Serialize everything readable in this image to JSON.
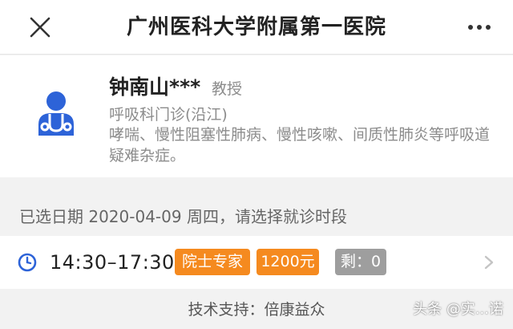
{
  "header": {
    "title": "广州医科大学附属第一医院",
    "close_icon": "close-icon",
    "more_icon": "more-dots-icon"
  },
  "doctor": {
    "icon": "doctor-stethoscope-icon",
    "name": "钟南山***",
    "title": "教授",
    "department": "呼吸科门诊(沿江)",
    "specialty": "哮喘、慢性阻塞性肺病、慢性咳嗽、间质性肺炎等呼吸道疑难杂症。"
  },
  "schedule": {
    "selected_date_text": "已选日期 2020-04-09 周四，请选择就诊时段"
  },
  "slot": {
    "icon": "clock-icon",
    "time": "14:30–17:30",
    "tag_expert": "院士专家",
    "tag_price": "1200元",
    "tag_remaining": "剩：0",
    "chevron_icon": "chevron-right-icon"
  },
  "footer": {
    "support_text": "技术支持：倍康益众"
  },
  "watermark": {
    "text": "头条 @实...诺"
  },
  "colors": {
    "accent_blue": "#2d63d8",
    "tag_orange": "#f58a1f",
    "tag_gray": "#9e9e9e",
    "background": "#f2f2f2"
  }
}
